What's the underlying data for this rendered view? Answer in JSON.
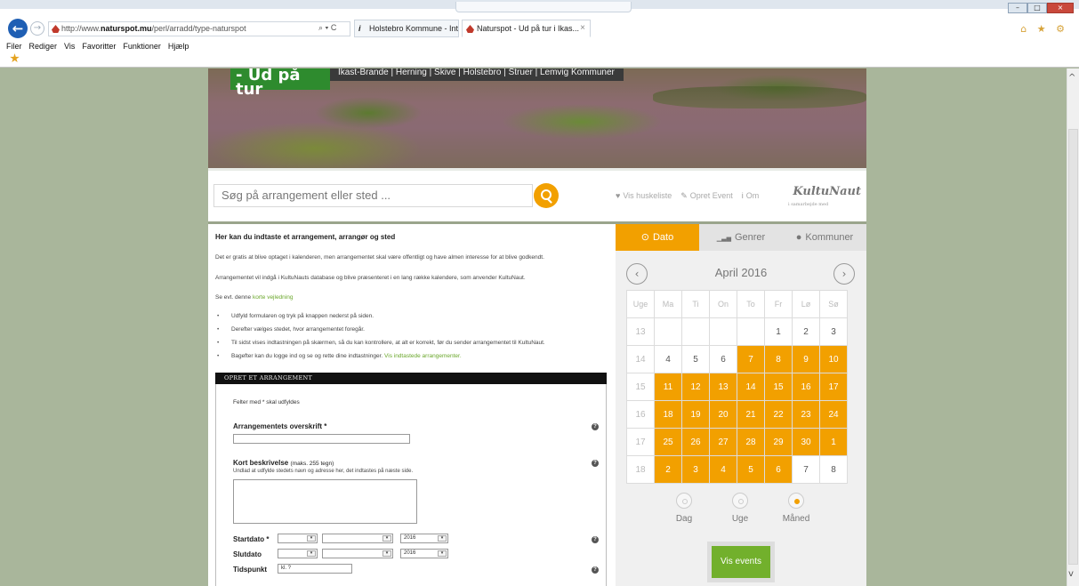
{
  "browser": {
    "url_prefix": "http://www.",
    "url_host": "naturspot.mu",
    "url_path": "/perl/arradd/type-naturspot",
    "addr_tools": "⌕ ▾ C",
    "tabs": [
      {
        "label": "Holstebro Kommune - Intrano..."
      },
      {
        "label": "Naturspot - Ud på tur i Ikas...",
        "close": "×"
      }
    ],
    "menu": [
      "Filer",
      "Rediger",
      "Vis",
      "Favoritter",
      "Funktioner",
      "Hjælp"
    ],
    "right_icons": "⌂ ★ ⚙",
    "window_buttons": [
      "–",
      "□",
      "×"
    ]
  },
  "banner": {
    "logo": "- Ud på tur",
    "municipalities": "Ikast-Brande | Herning | Skive | Holstebro | Struer | Lemvig Kommuner"
  },
  "search": {
    "placeholder": "Søg på arrangement eller sted ..."
  },
  "top_links": {
    "huskeliste": "Vis huskeliste",
    "opret": "Opret Event",
    "om": "Om"
  },
  "kultunaut": {
    "logo": "KultuNaut",
    "tagline": "i samarbejde med"
  },
  "intro": {
    "title": "Her kan du indtaste et arrangement, arrangør og sted",
    "p1": "Det er gratis at blive optaget i kalenderen, men arrangementet skal være offentligt og have almen interesse for at blive godkendt.",
    "p2": "Arrangementet vil indgå i KultuNauts database og blive præsenteret i en lang række kalendere, som anvender KultuNaut.",
    "p3_prefix": "Se evt. denne",
    "p3_link": "korte vejledning",
    "bullets": [
      "Udfyld formularen og tryk på knappen nederst på siden.",
      "Derefter vælges stedet, hvor arrangementet foregår.",
      "Til sidst vises indtastningen på skærmen, så du kan kontrollere, at alt er korrekt, før du sender arrangementet til KultuNaut."
    ],
    "bullet4_prefix": "Bagefter kan du logge ind og se og rette dine indtastninger.",
    "bullet4_link": "Vis indtastede arrangementer."
  },
  "form": {
    "header": "OPRET ET ARRANGEMENT",
    "required_note": "Felter med * skal udfyldes",
    "title_label": "Arrangementets overskrift *",
    "desc_label": "Kort beskrivelse",
    "desc_small": "(maks. 255 tegn)",
    "desc_hint": "Undlad at udfylde stedets navn og adresse her, det indtastes på næste side.",
    "start_label": "Startdato *",
    "end_label": "Slutdato",
    "time_label": "Tidspunkt",
    "start_year": "2016",
    "end_year": "2016",
    "time_value": "kl. ?",
    "help": "?"
  },
  "calendar": {
    "tabs": [
      {
        "icon": "⊙",
        "label": "Dato"
      },
      {
        "icon": "▁▃▅",
        "label": "Genrer"
      },
      {
        "icon": "●",
        "label": "Kommuner"
      }
    ],
    "prev": "‹",
    "next": "›",
    "month": "April 2016",
    "headers": [
      "Uge",
      "Ma",
      "Ti",
      "On",
      "To",
      "Fr",
      "Lø",
      "Sø"
    ],
    "weeks": [
      {
        "week": "13",
        "days": [
          "",
          "",
          "",
          "",
          "1",
          "2",
          "3"
        ],
        "on": [
          false,
          false,
          false,
          false,
          false,
          false,
          false
        ]
      },
      {
        "week": "14",
        "days": [
          "4",
          "5",
          "6",
          "7",
          "8",
          "9",
          "10"
        ],
        "on": [
          false,
          false,
          false,
          true,
          true,
          true,
          true
        ]
      },
      {
        "week": "15",
        "days": [
          "11",
          "12",
          "13",
          "14",
          "15",
          "16",
          "17"
        ],
        "on": [
          true,
          true,
          true,
          true,
          true,
          true,
          true
        ]
      },
      {
        "week": "16",
        "days": [
          "18",
          "19",
          "20",
          "21",
          "22",
          "23",
          "24"
        ],
        "on": [
          true,
          true,
          true,
          true,
          true,
          true,
          true
        ]
      },
      {
        "week": "17",
        "days": [
          "25",
          "26",
          "27",
          "28",
          "29",
          "30",
          "1"
        ],
        "on": [
          true,
          true,
          true,
          true,
          true,
          true,
          true
        ]
      },
      {
        "week": "18",
        "days": [
          "2",
          "3",
          "4",
          "5",
          "6",
          "7",
          "8"
        ],
        "on": [
          true,
          true,
          true,
          true,
          true,
          false,
          false
        ]
      }
    ],
    "views": [
      {
        "label": "Dag",
        "checked": false
      },
      {
        "label": "Uge",
        "checked": false
      },
      {
        "label": "Måned",
        "checked": true
      }
    ],
    "submit": "Vis events",
    "accent": "#f2a000",
    "button_color": "#72b02c"
  }
}
